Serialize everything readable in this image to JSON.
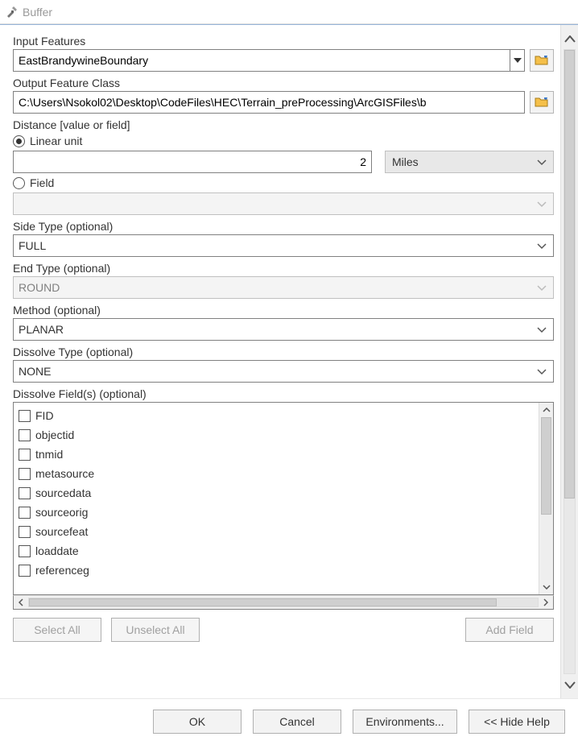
{
  "window": {
    "title": "Buffer"
  },
  "input_features": {
    "label": "Input Features",
    "value": "EastBrandywineBoundary"
  },
  "output_feature_class": {
    "label": "Output Feature Class",
    "value": "C:\\Users\\Nsokol02\\Desktop\\CodeFiles\\HEC\\Terrain_preProcessing\\ArcGISFiles\\b"
  },
  "distance": {
    "label": "Distance [value or field]",
    "linear_unit_label": "Linear unit",
    "value": "2",
    "unit": "Miles",
    "field_label": "Field",
    "field_value": ""
  },
  "side_type": {
    "label": "Side Type (optional)",
    "value": "FULL"
  },
  "end_type": {
    "label": "End Type (optional)",
    "value": "ROUND"
  },
  "method": {
    "label": "Method (optional)",
    "value": "PLANAR"
  },
  "dissolve_type": {
    "label": "Dissolve Type (optional)",
    "value": "NONE"
  },
  "dissolve_fields": {
    "label": "Dissolve Field(s) (optional)",
    "items": [
      "FID",
      "objectid",
      "tnmid",
      "metasource",
      "sourcedata",
      "sourceorig",
      "sourcefeat",
      "loaddate",
      "referenceg"
    ]
  },
  "buttons": {
    "select_all": "Select All",
    "unselect_all": "Unselect All",
    "add_field": "Add Field",
    "ok": "OK",
    "cancel": "Cancel",
    "environments": "Environments...",
    "hide_help": "<< Hide Help"
  }
}
